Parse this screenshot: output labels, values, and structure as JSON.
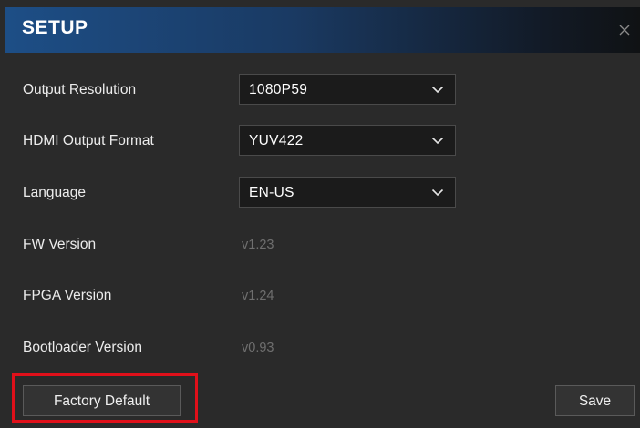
{
  "dialog": {
    "title": "SETUP",
    "close_icon": "close-icon"
  },
  "settings": {
    "output_resolution": {
      "label": "Output Resolution",
      "value": "1080P59"
    },
    "hdmi_output_format": {
      "label": "HDMI Output Format",
      "value": "YUV422"
    },
    "language": {
      "label": "Language",
      "value": "EN-US"
    }
  },
  "versions": {
    "fw": {
      "label": "FW Version",
      "value": "v1.23"
    },
    "fpga": {
      "label": "FPGA Version",
      "value": "v1.24"
    },
    "bootloader": {
      "label": "Bootloader Version",
      "value": "v0.93"
    }
  },
  "buttons": {
    "factory_default": "Factory Default",
    "save": "Save"
  },
  "colors": {
    "title_bar_start": "#1d4e86",
    "background": "#2a2a2a",
    "highlight": "#e0101a"
  }
}
